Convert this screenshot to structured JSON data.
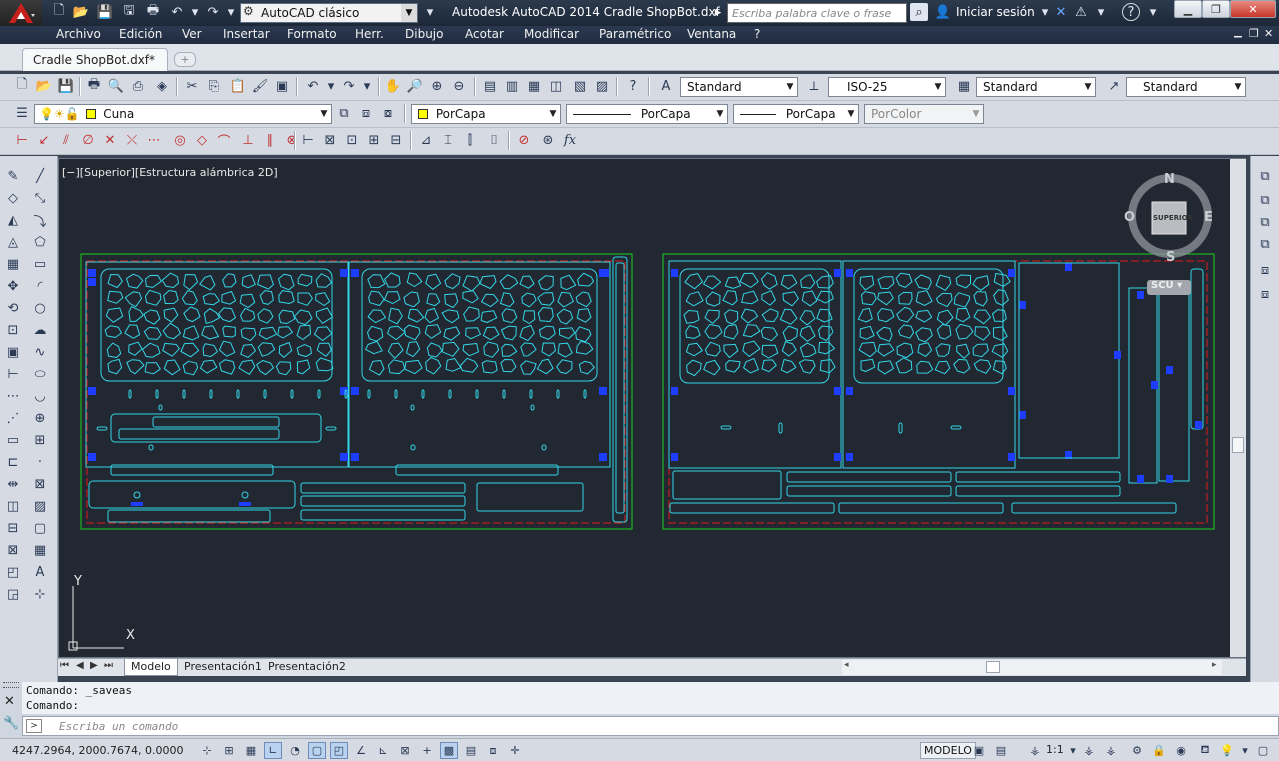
{
  "app": {
    "title": "Autodesk AutoCAD 2014    Cradle ShopBot.dxf",
    "workspace": "AutoCAD clásico",
    "search_placeholder": "Escriba palabra clave o frase",
    "signin": "Iniciar sesión",
    "help": "?"
  },
  "menu": [
    "Archivo",
    "Edición",
    "Ver",
    "Insertar",
    "Formato",
    "Herr.",
    "Dibujo",
    "Acotar",
    "Modificar",
    "Paramétrico",
    "Ventana",
    "?"
  ],
  "document_tab": "Cradle ShopBot.dxf*",
  "styles": {
    "text_style": "Standard",
    "dim_style": "ISO-25",
    "table_style": "Standard",
    "multileader_style": "Standard"
  },
  "layers": {
    "current_layer": "Cuna",
    "color": "PorCapa",
    "linetype": "PorCapa",
    "lineweight": "PorCapa",
    "plot_style": "PorColor"
  },
  "viewport_label": "[−][Superior][Estructura alámbrica 2D]",
  "viewcube": {
    "north": "N",
    "south": "S",
    "east": "E",
    "west": "O",
    "face": "SUPERIOR",
    "ucs": "SCU"
  },
  "ucs_axes": {
    "x": "X",
    "y": "Y"
  },
  "layout_tabs": [
    "Modelo",
    "Presentación1",
    "Presentación2"
  ],
  "command": {
    "history": [
      "Comando: _saveas",
      "Comando:"
    ],
    "placeholder": "Escriba un comando"
  },
  "status": {
    "coordinates": "4247.2964, 2000.7674, 0.0000",
    "model_button": "MODELO",
    "annotation_scale": "1:1"
  },
  "colors": {
    "canvas": "#222832",
    "cyan_geometry": "#33d6e6",
    "blue_tabs": "#1f3dff",
    "sheet_border": "#19d019",
    "margin_red": "#e01818",
    "app_red": "#c8201c"
  }
}
